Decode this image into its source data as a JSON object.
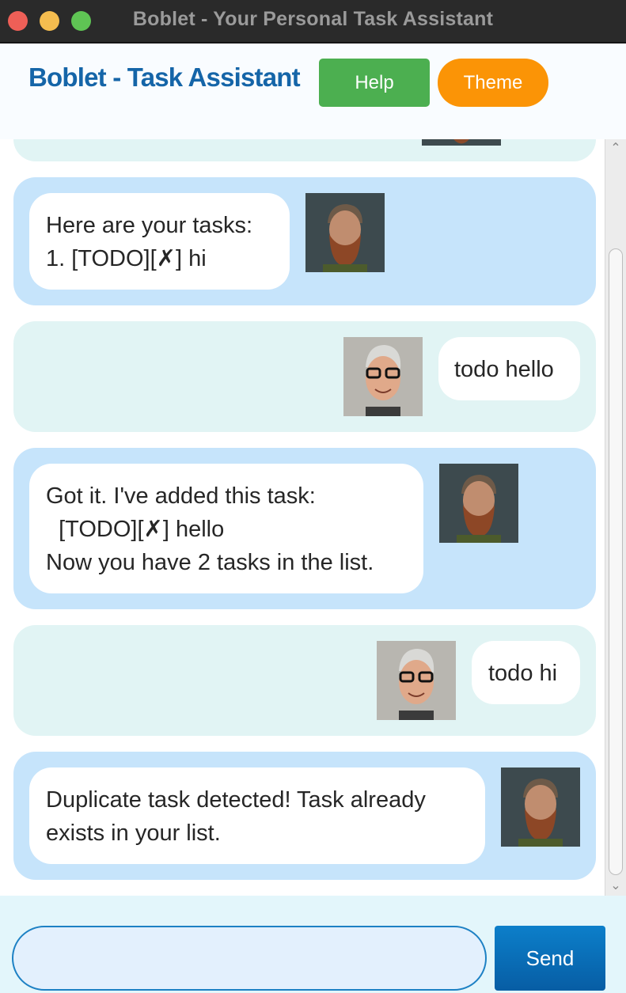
{
  "window": {
    "title": "Boblet - Your Personal Task Assistant"
  },
  "header": {
    "heading": "Boblet - Task Assistant",
    "help_label": "Help",
    "theme_label": "Theme"
  },
  "messages": [
    {
      "sender": "bot",
      "text": "Here are your tasks:\n1. [TODO][✗] hi"
    },
    {
      "sender": "user",
      "text": "todo hello"
    },
    {
      "sender": "bot",
      "text": "Got it. I've added this task:\n  [TODO][✗] hello\nNow you have 2 tasks in the list."
    },
    {
      "sender": "user",
      "text": "todo hi"
    },
    {
      "sender": "bot",
      "text": "Duplicate task detected! Task already\nexists in your list."
    }
  ],
  "input": {
    "value": "",
    "send_label": "Send"
  },
  "colors": {
    "accent": "#1565a8",
    "help_button": "#4caf50",
    "theme_button": "#fb9406",
    "bot_row": "#c6e4fb",
    "user_row": "#e1f4f4",
    "send_button": "#0a6fb7"
  },
  "icons": {
    "bot_avatar": "bearded-man-avatar",
    "user_avatar": "glasses-man-avatar"
  }
}
